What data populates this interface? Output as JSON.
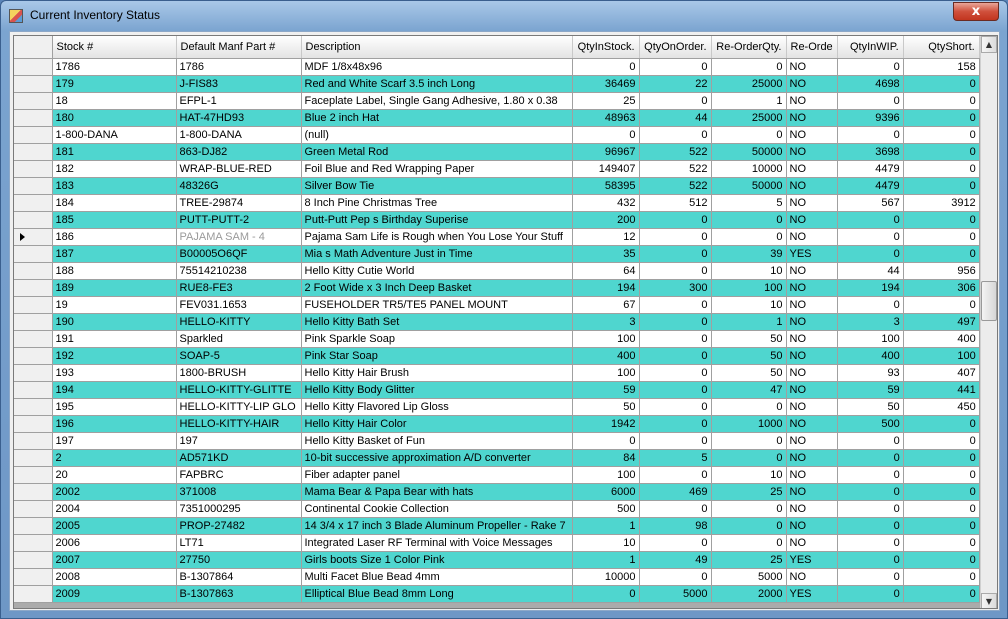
{
  "window": {
    "title": "Current Inventory Status",
    "close_glyph": "x"
  },
  "grid": {
    "columns": [
      {
        "key": "stock",
        "label": "Stock #"
      },
      {
        "key": "manf",
        "label": "Default Manf Part #"
      },
      {
        "key": "desc",
        "label": "Description"
      },
      {
        "key": "qty_in_stock",
        "label": "QtyInStock."
      },
      {
        "key": "qty_on_order",
        "label": "QtyOnOrder."
      },
      {
        "key": "reorder_qty",
        "label": "Re-OrderQty."
      },
      {
        "key": "reorder",
        "label": "Re-Orde"
      },
      {
        "key": "qty_in_wip",
        "label": "QtyInWIP."
      },
      {
        "key": "qty_short",
        "label": "QtyShort."
      }
    ],
    "current_row": 10,
    "rows": [
      [
        "1786",
        "1786",
        "MDF 1/8x48x96",
        "0",
        "0",
        "0",
        "NO",
        "0",
        "158"
      ],
      [
        "179",
        "J-FIS83",
        "Red and White Scarf 3.5 inch Long",
        "36469",
        "22",
        "25000",
        "NO",
        "4698",
        "0"
      ],
      [
        "18",
        "EFPL-1",
        "Faceplate Label, Single Gang Adhesive, 1.80 x 0.38",
        "25",
        "0",
        "1",
        "NO",
        "0",
        "0"
      ],
      [
        "180",
        "HAT-47HD93",
        "Blue 2 inch Hat",
        "48963",
        "44",
        "25000",
        "NO",
        "9396",
        "0"
      ],
      [
        "1-800-DANA",
        "1-800-DANA",
        "(null)",
        "0",
        "0",
        "0",
        "NO",
        "0",
        "0"
      ],
      [
        "181",
        "863-DJ82",
        "Green Metal Rod",
        "96967",
        "522",
        "50000",
        "NO",
        "3698",
        "0"
      ],
      [
        "182",
        "WRAP-BLUE-RED",
        "Foil Blue and Red Wrapping Paper",
        "149407",
        "522",
        "10000",
        "NO",
        "4479",
        "0"
      ],
      [
        "183",
        "48326G",
        "Silver Bow Tie",
        "58395",
        "522",
        "50000",
        "NO",
        "4479",
        "0"
      ],
      [
        "184",
        "TREE-29874",
        "8 Inch Pine Christmas Tree",
        "432",
        "512",
        "5",
        "NO",
        "567",
        "3912"
      ],
      [
        "185",
        "PUTT-PUTT-2",
        "Putt-Putt Pep s Birthday Superise",
        "200",
        "0",
        "0",
        "NO",
        "0",
        "0"
      ],
      [
        "186",
        "PAJAMA SAM - 4",
        "Pajama Sam Life is Rough when You Lose Your Stuff",
        "12",
        "0",
        "0",
        "NO",
        "0",
        "0"
      ],
      [
        "187",
        "B00005O6QF",
        "Mia s Math Adventure Just in Time",
        "35",
        "0",
        "39",
        "YES",
        "0",
        "0"
      ],
      [
        "188",
        "75514210238",
        "Hello Kitty Cutie World",
        "64",
        "0",
        "10",
        "NO",
        "44",
        "956"
      ],
      [
        "189",
        "RUE8-FE3",
        "2 Foot Wide x 3 Inch Deep Basket",
        "194",
        "300",
        "100",
        "NO",
        "194",
        "306"
      ],
      [
        "19",
        "FEV031.1653",
        "FUSEHOLDER TR5/TE5 PANEL MOUNT",
        "67",
        "0",
        "10",
        "NO",
        "0",
        "0"
      ],
      [
        "190",
        "HELLO-KITTY",
        "Hello Kitty Bath Set",
        "3",
        "0",
        "1",
        "NO",
        "3",
        "497"
      ],
      [
        "191",
        "Sparkled",
        "Pink Sparkle Soap",
        "100",
        "0",
        "50",
        "NO",
        "100",
        "400"
      ],
      [
        "192",
        "SOAP-5",
        "Pink Star Soap",
        "400",
        "0",
        "50",
        "NO",
        "400",
        "100"
      ],
      [
        "193",
        "1800-BRUSH",
        "Hello Kitty Hair Brush",
        "100",
        "0",
        "50",
        "NO",
        "93",
        "407"
      ],
      [
        "194",
        "HELLO-KITTY-GLITTE",
        "Hello Kitty Body Glitter",
        "59",
        "0",
        "47",
        "NO",
        "59",
        "441"
      ],
      [
        "195",
        "HELLO-KITTY-LIP GLO",
        "Hello Kitty Flavored Lip Gloss",
        "50",
        "0",
        "0",
        "NO",
        "50",
        "450"
      ],
      [
        "196",
        "HELLO-KITTY-HAIR",
        "Hello Kitty Hair Color",
        "1942",
        "0",
        "1000",
        "NO",
        "500",
        "0"
      ],
      [
        "197",
        "197",
        "Hello Kitty Basket of Fun",
        "0",
        "0",
        "0",
        "NO",
        "0",
        "0"
      ],
      [
        "2",
        "AD571KD",
        "10-bit successive approximation A/D converter",
        "84",
        "5",
        "0",
        "NO",
        "0",
        "0"
      ],
      [
        "20",
        "FAPBRC",
        "Fiber adapter panel",
        "100",
        "0",
        "10",
        "NO",
        "0",
        "0"
      ],
      [
        "2002",
        "371008",
        "Mama Bear & Papa Bear with hats",
        "6000",
        "469",
        "25",
        "NO",
        "0",
        "0"
      ],
      [
        "2004",
        "7351000295",
        "Continental Cookie Collection",
        "500",
        "0",
        "0",
        "NO",
        "0",
        "0"
      ],
      [
        "2005",
        "PROP-27482",
        "14 3/4 x 17 inch  3 Blade Aluminum Propeller - Rake 7",
        "1",
        "98",
        "0",
        "NO",
        "0",
        "0"
      ],
      [
        "2006",
        "LT71",
        "Integrated Laser RF Terminal with Voice Messages",
        "10",
        "0",
        "0",
        "NO",
        "0",
        "0"
      ],
      [
        "2007",
        "27750",
        "Girls boots Size 1 Color Pink",
        "1",
        "49",
        "25",
        "YES",
        "0",
        "0"
      ],
      [
        "2008",
        "B-1307864",
        "Multi Facet Blue Bead 4mm",
        "10000",
        "0",
        "5000",
        "NO",
        "0",
        "0"
      ],
      [
        "2009",
        "B-1307863",
        "Elliptical Blue Bead 8mm Long",
        "0",
        "5000",
        "2000",
        "YES",
        "0",
        "0"
      ]
    ]
  },
  "scrollbar": {
    "up_glyph": "▲",
    "down_glyph": "▼"
  }
}
